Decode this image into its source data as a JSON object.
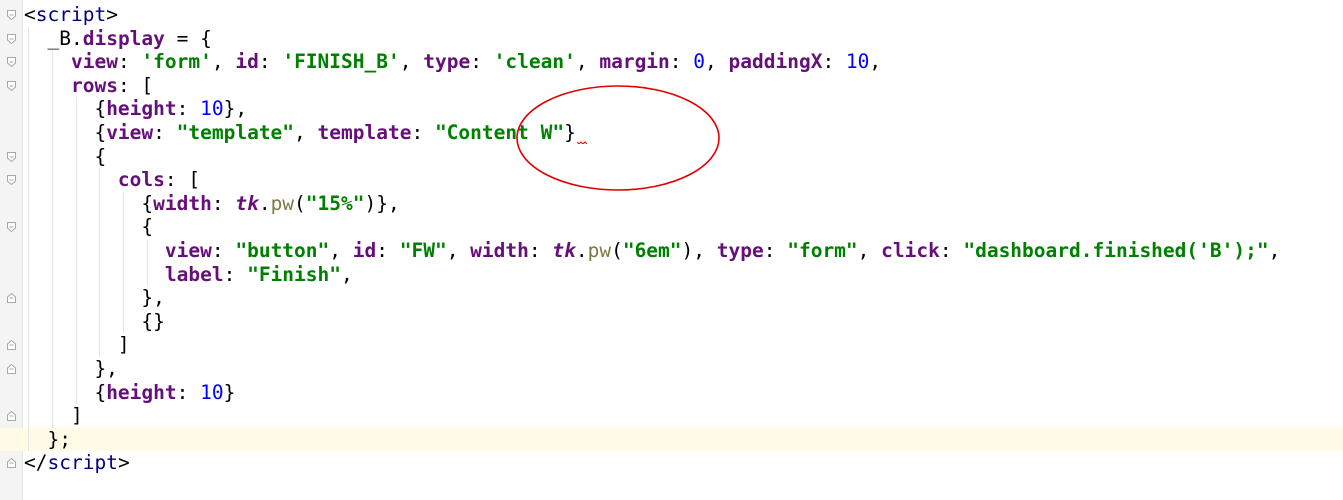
{
  "editor": {
    "lines": [
      [
        {
          "t": "<",
          "c": "plain"
        },
        {
          "t": "script",
          "c": "tag"
        },
        {
          "t": ">",
          "c": "plain"
        }
      ],
      [
        {
          "t": "  _B",
          "c": "var"
        },
        {
          "t": ".",
          "c": "plain"
        },
        {
          "t": "display",
          "c": "prop"
        },
        {
          "t": " = {",
          "c": "plain"
        }
      ],
      [
        {
          "t": "    ",
          "c": "plain"
        },
        {
          "t": "view",
          "c": "prop"
        },
        {
          "t": ": ",
          "c": "plain"
        },
        {
          "t": "'form'",
          "c": "str"
        },
        {
          "t": ", ",
          "c": "plain"
        },
        {
          "t": "id",
          "c": "prop"
        },
        {
          "t": ": ",
          "c": "plain"
        },
        {
          "t": "'FINISH_B'",
          "c": "str"
        },
        {
          "t": ", ",
          "c": "plain"
        },
        {
          "t": "type",
          "c": "prop"
        },
        {
          "t": ": ",
          "c": "plain"
        },
        {
          "t": "'clean'",
          "c": "str"
        },
        {
          "t": ", ",
          "c": "plain"
        },
        {
          "t": "margin",
          "c": "prop"
        },
        {
          "t": ": ",
          "c": "plain"
        },
        {
          "t": "0",
          "c": "num"
        },
        {
          "t": ", ",
          "c": "plain"
        },
        {
          "t": "paddingX",
          "c": "prop"
        },
        {
          "t": ": ",
          "c": "plain"
        },
        {
          "t": "10",
          "c": "num"
        },
        {
          "t": ",",
          "c": "plain"
        }
      ],
      [
        {
          "t": "    ",
          "c": "plain"
        },
        {
          "t": "rows",
          "c": "prop"
        },
        {
          "t": ": [",
          "c": "plain"
        }
      ],
      [
        {
          "t": "      {",
          "c": "plain"
        },
        {
          "t": "height",
          "c": "prop"
        },
        {
          "t": ": ",
          "c": "plain"
        },
        {
          "t": "10",
          "c": "num"
        },
        {
          "t": "},",
          "c": "plain"
        }
      ],
      [
        {
          "t": "      {",
          "c": "plain"
        },
        {
          "t": "view",
          "c": "prop"
        },
        {
          "t": ": ",
          "c": "plain"
        },
        {
          "t": "\"template\"",
          "c": "str"
        },
        {
          "t": ", ",
          "c": "plain"
        },
        {
          "t": "template",
          "c": "prop"
        },
        {
          "t": ": ",
          "c": "plain"
        },
        {
          "t": "\"Content W\"",
          "c": "str"
        },
        {
          "t": "}",
          "c": "plain"
        },
        {
          "squiggle": true
        }
      ],
      [
        {
          "t": "      {",
          "c": "plain"
        }
      ],
      [
        {
          "t": "        ",
          "c": "plain"
        },
        {
          "t": "cols",
          "c": "prop"
        },
        {
          "t": ": [",
          "c": "plain"
        }
      ],
      [
        {
          "t": "          {",
          "c": "plain"
        },
        {
          "t": "width",
          "c": "prop"
        },
        {
          "t": ": ",
          "c": "plain"
        },
        {
          "t": "tk",
          "c": "it"
        },
        {
          "t": ".",
          "c": "plain"
        },
        {
          "t": "pw",
          "c": "fn"
        },
        {
          "t": "(",
          "c": "plain"
        },
        {
          "t": "\"15%\"",
          "c": "str"
        },
        {
          "t": ")},",
          "c": "plain"
        }
      ],
      [
        {
          "t": "          {",
          "c": "plain"
        }
      ],
      [
        {
          "t": "            ",
          "c": "plain"
        },
        {
          "t": "view",
          "c": "prop"
        },
        {
          "t": ": ",
          "c": "plain"
        },
        {
          "t": "\"button\"",
          "c": "str"
        },
        {
          "t": ", ",
          "c": "plain"
        },
        {
          "t": "id",
          "c": "prop"
        },
        {
          "t": ": ",
          "c": "plain"
        },
        {
          "t": "\"FW\"",
          "c": "str"
        },
        {
          "t": ", ",
          "c": "plain"
        },
        {
          "t": "width",
          "c": "prop"
        },
        {
          "t": ": ",
          "c": "plain"
        },
        {
          "t": "tk",
          "c": "it"
        },
        {
          "t": ".",
          "c": "plain"
        },
        {
          "t": "pw",
          "c": "fn"
        },
        {
          "t": "(",
          "c": "plain"
        },
        {
          "t": "\"6em\"",
          "c": "str"
        },
        {
          "t": "), ",
          "c": "plain"
        },
        {
          "t": "type",
          "c": "prop"
        },
        {
          "t": ": ",
          "c": "plain"
        },
        {
          "t": "\"form\"",
          "c": "str"
        },
        {
          "t": ", ",
          "c": "plain"
        },
        {
          "t": "click",
          "c": "prop"
        },
        {
          "t": ": ",
          "c": "plain"
        },
        {
          "t": "\"dashboard.finished('B');\"",
          "c": "str"
        },
        {
          "t": ",",
          "c": "plain"
        }
      ],
      [
        {
          "t": "            ",
          "c": "plain"
        },
        {
          "t": "label",
          "c": "prop"
        },
        {
          "t": ": ",
          "c": "plain"
        },
        {
          "t": "\"Finish\"",
          "c": "str"
        },
        {
          "t": ",",
          "c": "plain"
        }
      ],
      [
        {
          "t": "          },",
          "c": "plain"
        }
      ],
      [
        {
          "t": "          {}",
          "c": "plain"
        }
      ],
      [
        {
          "t": "        ]",
          "c": "plain"
        }
      ],
      [
        {
          "t": "      },",
          "c": "plain"
        }
      ],
      [
        {
          "t": "      {",
          "c": "plain"
        },
        {
          "t": "height",
          "c": "prop"
        },
        {
          "t": ": ",
          "c": "plain"
        },
        {
          "t": "10",
          "c": "num"
        },
        {
          "t": "}",
          "c": "plain"
        }
      ],
      [
        {
          "t": "    ]",
          "c": "plain"
        }
      ],
      [
        {
          "t": "  };",
          "c": "plain"
        }
      ],
      [
        {
          "t": "</",
          "c": "plain"
        },
        {
          "t": "script",
          "c": "tag"
        },
        {
          "t": ">",
          "c": "plain"
        }
      ]
    ],
    "caret_line": 18,
    "folds": [
      {
        "line": 0,
        "dir": "open"
      },
      {
        "line": 1,
        "dir": "open"
      },
      {
        "line": 2,
        "dir": "open"
      },
      {
        "line": 3,
        "dir": "open"
      },
      {
        "line": 6,
        "dir": "open"
      },
      {
        "line": 7,
        "dir": "open"
      },
      {
        "line": 9,
        "dir": "open"
      },
      {
        "line": 12,
        "dir": "close"
      },
      {
        "line": 14,
        "dir": "close"
      },
      {
        "line": 15,
        "dir": "close"
      },
      {
        "line": 17,
        "dir": "close"
      },
      {
        "line": 18,
        "dir": "close"
      },
      {
        "line": 19,
        "dir": "close"
      }
    ],
    "indent_guide_levels": [
      0,
      1,
      2,
      2,
      3,
      3,
      3,
      4,
      5,
      5,
      6,
      6,
      5,
      5,
      4,
      3,
      3,
      2,
      1,
      0
    ]
  },
  "colors": {
    "tag": "#000080",
    "property": "#660e7a",
    "string": "#008000",
    "number": "#0000ff",
    "function": "#7a7a43",
    "caret_line_bg": "#fffbe6",
    "annotation": "#e00000"
  }
}
